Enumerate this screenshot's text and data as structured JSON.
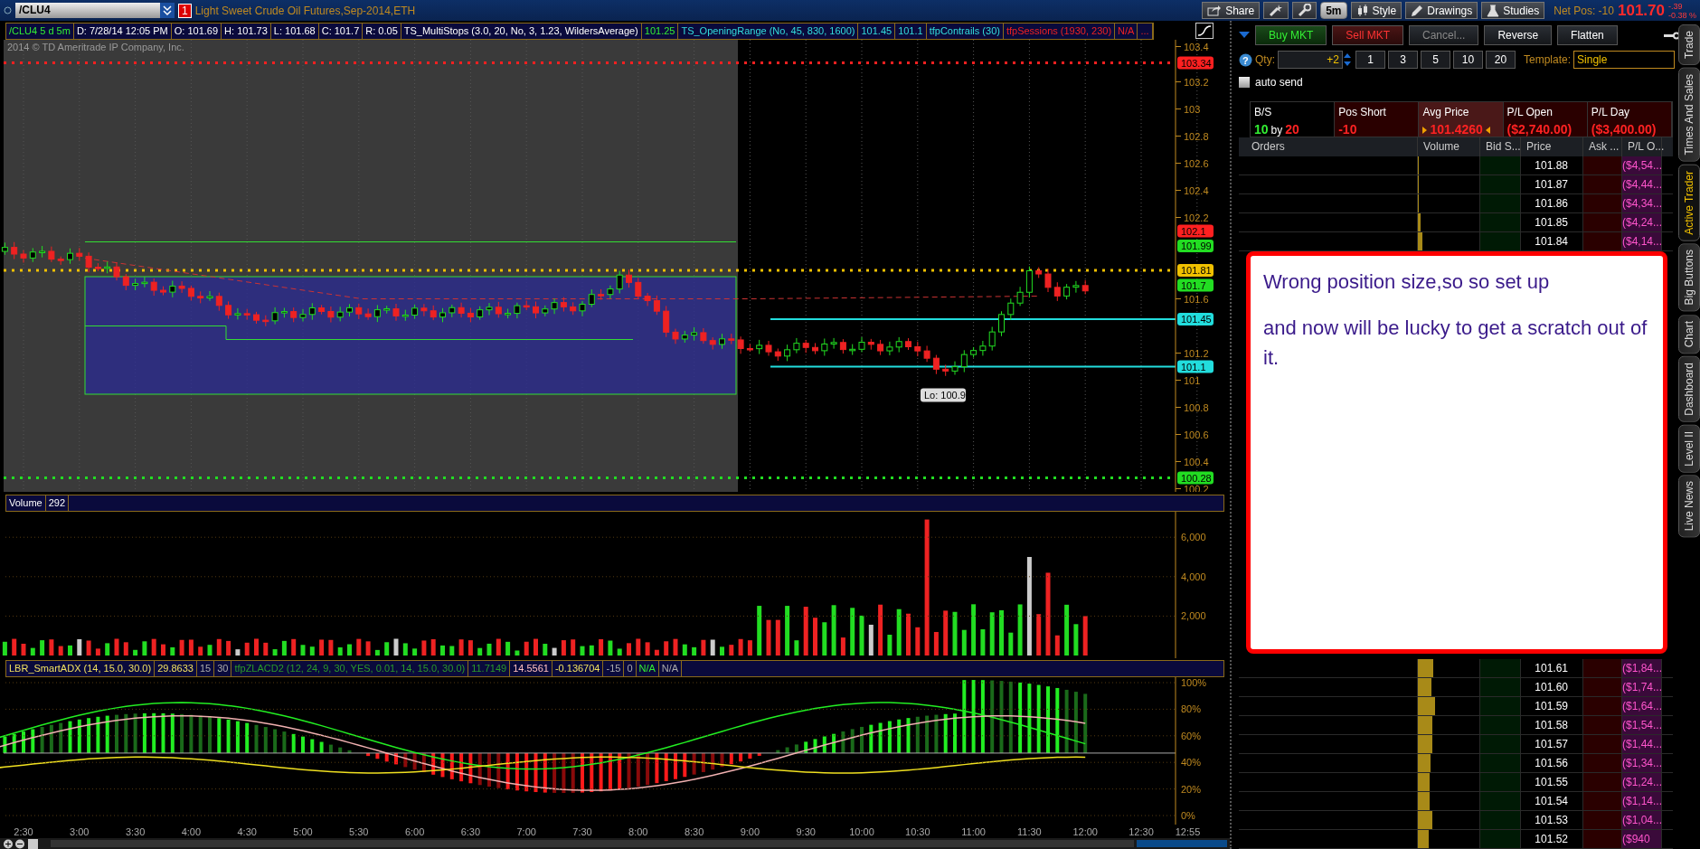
{
  "toolbar": {
    "symbol": "/CLU4",
    "alert_count": "1",
    "description": "Light Sweet Crude Oil Futures,Sep-2014,ETH",
    "tools": [
      {
        "kind": "share",
        "label": "Share"
      },
      {
        "kind": "wand"
      },
      {
        "kind": "wrench"
      },
      {
        "kind": "interval",
        "label": "5m"
      },
      {
        "kind": "style",
        "label": "Style"
      },
      {
        "kind": "drawings",
        "label": "Drawings"
      },
      {
        "kind": "studies",
        "label": "Studies"
      }
    ],
    "net_pos_label": "Net Pos: -10",
    "last_price": "101.70",
    "change": "-.39",
    "change_pct": "-0.38 %"
  },
  "chart": {
    "header": [
      {
        "text": "/CLU4 5 d 5m",
        "kind": "symbol"
      },
      {
        "text": "D: 7/28/14 12:05 PM",
        "kind": "info"
      },
      {
        "text": "O: 101.69",
        "kind": "info"
      },
      {
        "text": "H: 101.73",
        "kind": "info"
      },
      {
        "text": "L: 101.68",
        "kind": "info"
      },
      {
        "text": "C: 101.7",
        "kind": "info"
      },
      {
        "text": "R: 0.05",
        "kind": "info"
      },
      {
        "text": "TS_MultiStops (3.0, 20, No, 3, 1.23, WildersAverage)",
        "kind": "info"
      },
      {
        "text": "101.25",
        "kind": "symbol"
      },
      {
        "text": "TS_OpeningRange (No, 45, 830, 1600)",
        "kind": "range"
      },
      {
        "text": "101.45",
        "kind": "range"
      },
      {
        "text": "101.1",
        "kind": "range"
      },
      {
        "text": "tfpContrails (30)",
        "kind": "range"
      },
      {
        "text": "tfpSessions (1930, 230)",
        "kind": "session"
      },
      {
        "text": "N/A",
        "kind": "session"
      },
      {
        "text": "...",
        "kind": "session"
      }
    ],
    "copyright": "2014 © TD Ameritrade IP Company, Inc.",
    "price_ticks": [
      "103.4",
      "103.2",
      "103",
      "102.8",
      "102.6",
      "102.4",
      "102.2",
      "101.6",
      "101.2",
      "101",
      "100.8",
      "100.6",
      "100.4",
      "100.2"
    ],
    "price_labels": [
      {
        "text": "103.34",
        "color": "#ff2020"
      },
      {
        "text": "102.1",
        "color": "#ff2020"
      },
      {
        "text": "101.99",
        "color": "#22dd22"
      },
      {
        "text": "101.81",
        "color": "#f0c000"
      },
      {
        "text": "101.7",
        "color": "#22dd22"
      },
      {
        "text": "101.45",
        "color": "#22dddd"
      },
      {
        "text": "101.1",
        "color": "#22dddd"
      },
      {
        "text": "100.28",
        "color": "#22dd22"
      }
    ],
    "low_marker": "Lo: 100.9",
    "volume": {
      "header": [
        "Volume",
        "292"
      ],
      "ticks": [
        "6,000",
        "4,000",
        "2,000"
      ]
    },
    "indicator": {
      "header": [
        {
          "text": "LBR_SmartADX (14, 15.0, 30.0)",
          "kind": "adx"
        },
        {
          "text": "29.8633",
          "kind": "adx"
        },
        {
          "text": "15",
          "kind": "param"
        },
        {
          "text": "30",
          "kind": "param"
        },
        {
          "text": "tfpZLACD2 (12, 24, 9, 30, YES, 0.01, 14, 15.0, 30.0)",
          "kind": "zlacd"
        },
        {
          "text": "11.7149",
          "kind": "zlacd"
        },
        {
          "text": "14.5561",
          "kind": "signal"
        },
        {
          "text": "-0.136704",
          "kind": "adx"
        },
        {
          "text": "-15",
          "kind": "param"
        },
        {
          "text": "0",
          "kind": "param"
        },
        {
          "text": "N/A",
          "kind": "status"
        },
        {
          "text": "N/A",
          "kind": "param"
        }
      ],
      "ticks": [
        "100%",
        "80%",
        "60%",
        "40%",
        "20%",
        "0%"
      ]
    },
    "time_labels": [
      "2:30",
      "3:00",
      "3:30",
      "4:00",
      "4:30",
      "5:00",
      "5:30",
      "6:00",
      "6:30",
      "7:00",
      "7:30",
      "8:00",
      "8:30",
      "9:00",
      "9:30",
      "10:00",
      "10:30",
      "11:00",
      "11:30",
      "12:00",
      "12:30",
      "12:55"
    ]
  },
  "trade": {
    "buttons": [
      {
        "label": "Buy MKT",
        "kind": "buy",
        "disabled": false
      },
      {
        "label": "Sell MKT",
        "kind": "sell",
        "disabled": false
      },
      {
        "label": "Cancel...",
        "kind": "plain",
        "disabled": true
      },
      {
        "label": "Reverse",
        "kind": "plain",
        "disabled": false
      },
      {
        "label": "Flatten",
        "kind": "plain",
        "disabled": false
      }
    ],
    "help": "?",
    "qty_label": "Qty:",
    "qty": "+2",
    "quick_qty": [
      "1",
      "3",
      "5",
      "10",
      "20"
    ],
    "template_label": "Template:",
    "template": "Single",
    "auto_send": {
      "label": "auto send",
      "checked": false
    },
    "position": [
      {
        "kind": "bs",
        "label": "B/S",
        "bid": "10",
        "sep": "by",
        "ask": "20"
      },
      {
        "kind": "value",
        "label": "Pos Short",
        "value": "-10",
        "highlighted": false
      },
      {
        "kind": "marked",
        "label": "Avg Price",
        "value": "101.4260",
        "highlighted": true
      },
      {
        "kind": "value",
        "label": "P/L Open",
        "value": "($2,740.00)",
        "highlighted": false
      },
      {
        "kind": "value",
        "label": "P/L Day",
        "value": "($3,400.00)",
        "highlighted": false
      }
    ],
    "columns": [
      "Orders",
      "Volume",
      "Bid S...",
      "Price",
      "Ask ...",
      "P/L O..."
    ],
    "rows_top": [
      {
        "price": "101.88",
        "level": 0.01,
        "pl": "($4,54..."
      },
      {
        "price": "101.87",
        "level": 0.02,
        "pl": "($4,44..."
      },
      {
        "price": "101.86",
        "level": 0.02,
        "pl": "($4,34..."
      },
      {
        "price": "101.85",
        "level": 0.04,
        "pl": "($4,24..."
      },
      {
        "price": "101.84",
        "level": 0.07,
        "pl": "($4,14..."
      }
    ],
    "rows_bottom": [
      {
        "price": "101.61",
        "level": 0.25,
        "pl": "($1,84..."
      },
      {
        "price": "101.60",
        "level": 0.22,
        "pl": "($1,74..."
      },
      {
        "price": "101.59",
        "level": 0.28,
        "pl": "($1,64..."
      },
      {
        "price": "101.58",
        "level": 0.23,
        "pl": "($1,54..."
      },
      {
        "price": "101.57",
        "level": 0.23,
        "pl": "($1,44..."
      },
      {
        "price": "101.56",
        "level": 0.2,
        "pl": "($1,34..."
      },
      {
        "price": "101.55",
        "level": 0.19,
        "pl": "($1,24..."
      },
      {
        "price": "101.54",
        "level": 0.19,
        "pl": "($1,14..."
      },
      {
        "price": "101.53",
        "level": 0.23,
        "pl": "($1,04..."
      },
      {
        "price": "101.52",
        "level": 0.17,
        "pl": "($940"
      }
    ]
  },
  "note": [
    "Wrong position size,so so set up",
    "and now will be lucky to get a scratch out of it."
  ],
  "side_tabs": [
    {
      "label": "Trade",
      "selected": false
    },
    {
      "label": "Times And Sales",
      "selected": false
    },
    {
      "label": "Active Trader",
      "selected": true
    },
    {
      "label": "Big Buttons",
      "selected": false
    },
    {
      "label": "Chart",
      "selected": false
    },
    {
      "label": "Dashboard",
      "selected": false
    },
    {
      "label": "Level II",
      "selected": false
    },
    {
      "label": "Live News",
      "selected": false
    }
  ]
}
